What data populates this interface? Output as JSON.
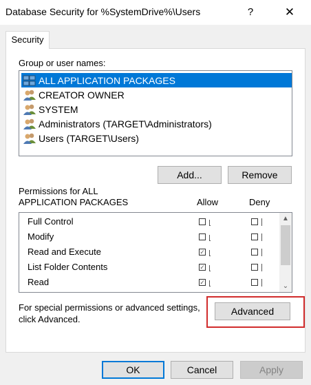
{
  "window": {
    "title": "Database Security for %SystemDrive%\\Users",
    "help_glyph": "?",
    "close_glyph": "✕"
  },
  "tab": {
    "label": "Security"
  },
  "group_label": "Group or user names:",
  "users": [
    {
      "name": "ALL APPLICATION PACKAGES",
      "selected": true,
      "icon": "app-packages-icon"
    },
    {
      "name": "CREATOR OWNER",
      "selected": false,
      "icon": "users-icon"
    },
    {
      "name": "SYSTEM",
      "selected": false,
      "icon": "users-icon"
    },
    {
      "name": "Administrators (TARGET\\Administrators)",
      "selected": false,
      "icon": "users-icon"
    },
    {
      "name": "Users (TARGET\\Users)",
      "selected": false,
      "icon": "users-icon"
    }
  ],
  "buttons": {
    "add": "Add...",
    "remove": "Remove",
    "advanced": "Advanced",
    "ok": "OK",
    "cancel": "Cancel",
    "apply": "Apply"
  },
  "permissions": {
    "header_line1": "Permissions for ALL",
    "header_line2": "APPLICATION PACKAGES",
    "allow_label": "Allow",
    "deny_label": "Deny",
    "rows": [
      {
        "name": "Full Control",
        "allow": false,
        "deny": false
      },
      {
        "name": "Modify",
        "allow": false,
        "deny": false
      },
      {
        "name": "Read and Execute",
        "allow": true,
        "deny": false
      },
      {
        "name": "List Folder Contents",
        "allow": true,
        "deny": false
      },
      {
        "name": "Read",
        "allow": true,
        "deny": false
      }
    ]
  },
  "special": {
    "line1": "For special permissions or advanced settings,",
    "line2": "click Advanced."
  },
  "scrollbar": {
    "up_glyph": "▲",
    "down_glyph": "⌄"
  },
  "colors": {
    "selection": "#0078d7",
    "highlight_border": "#d12b2b"
  }
}
